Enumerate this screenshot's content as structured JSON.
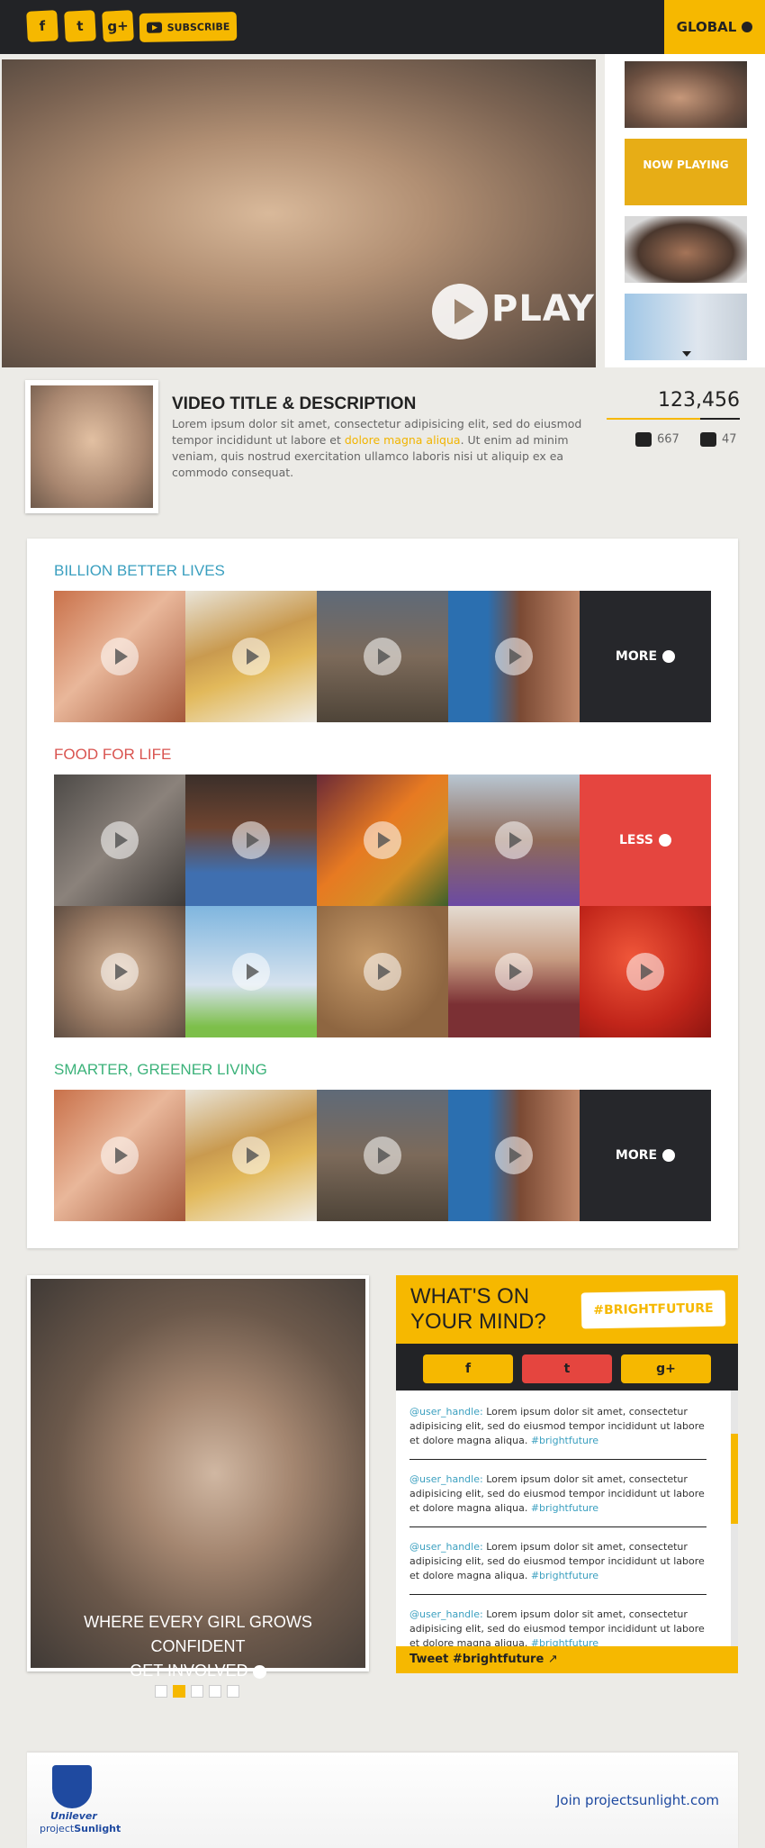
{
  "header": {
    "social_icons": [
      {
        "name": "facebook-icon",
        "glyph": "f"
      },
      {
        "name": "twitter-icon",
        "glyph": "t"
      },
      {
        "name": "google-plus-icon",
        "glyph": "g+"
      }
    ],
    "subscribe_label": "SUBSCRIBE",
    "global_label": "GLOBAL",
    "accent_color": "#f6b800",
    "dark_color": "#222326"
  },
  "hero": {
    "play_label": "PLAY",
    "now_playing_label": "NOW PLAYING"
  },
  "video": {
    "title": "VIDEO TITLE & DESCRIPTION",
    "desc_before": "Lorem ipsum dolor sit amet, consectetur adipisicing elit, sed do eiusmod tempor incididunt ut labore et ",
    "desc_highlight": "dolore magna aliqua",
    "desc_after": ". Ut enim ad minim veniam, quis nostrud exercitation ullamco laboris nisi ut aliquip ex ea commodo consequat.",
    "views": "123,456",
    "likes": "667",
    "dislikes": "47",
    "like_ratio": 0.7
  },
  "collections": [
    {
      "title": "BILLION BETTER LIVES",
      "color": "#3a9fbf",
      "toggle_label": "MORE"
    },
    {
      "title": "FOOD FOR LIFE",
      "color": "#d9534f",
      "toggle_label": "LESS"
    },
    {
      "title": "SMARTER, GREENER LIVING",
      "color": "#3cb27a",
      "toggle_label": "MORE"
    }
  ],
  "feature": {
    "caption_line1": "WHERE EVERY GIRL GROWS CONFIDENT",
    "caption_line2": "GET INVOLVED",
    "pages": 5,
    "active_page": 2
  },
  "social": {
    "heading": "WHAT'S ON YOUR MIND?",
    "hashtag": "#BRIGHTFUTURE",
    "buttons": [
      "f",
      "t",
      "g+"
    ],
    "posts": [
      {
        "handle": "@user_handle:",
        "text": " Lorem ipsum dolor sit amet, consectetur adipisicing elit, sed do eiusmod tempor incididunt ut labore et dolore magna aliqua. ",
        "tag": "#brightfuture"
      },
      {
        "handle": "@user_handle:",
        "text": " Lorem ipsum dolor sit amet, consectetur adipisicing elit, sed do eiusmod tempor incididunt ut labore et dolore magna aliqua. ",
        "tag": "#brightfuture"
      },
      {
        "handle": "@user_handle:",
        "text": " Lorem ipsum dolor sit amet, consectetur adipisicing elit, sed do eiusmod tempor incididunt ut labore et dolore magna aliqua. ",
        "tag": "#brightfuture"
      },
      {
        "handle": "@user_handle:",
        "text": " Lorem ipsum dolor sit amet, consectetur adipisicing elit, sed do eiusmod tempor incididunt ut labore et dolore magna aliqua. ",
        "tag": "#brightfuture"
      }
    ],
    "tweet_label": "Tweet #brightfuture"
  },
  "footer": {
    "brand": "Unilever",
    "project_prefix": "project",
    "project_name": "Sunlight",
    "join_label": "Join projectsunlight.com"
  }
}
